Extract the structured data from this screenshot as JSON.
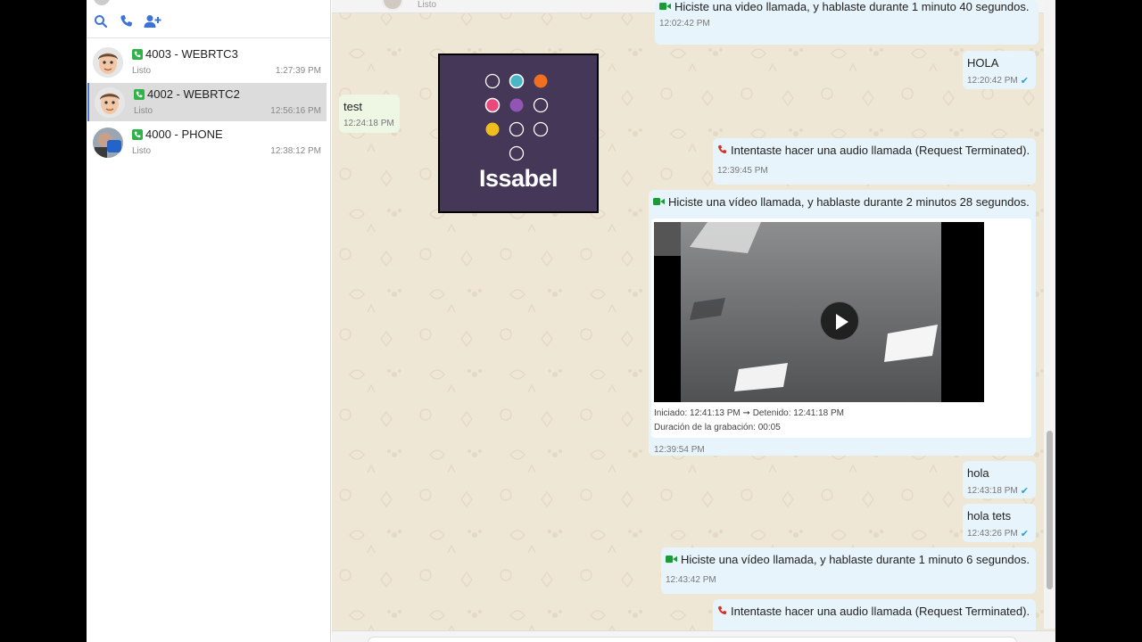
{
  "sidebar": {
    "toolbar": {
      "icons": [
        "search-icon",
        "phone-icon",
        "add-user-icon"
      ]
    },
    "contacts": [
      {
        "name": "4003 - WEBRTC3",
        "status": "Listo",
        "time": "1:27:39 PM",
        "active": false
      },
      {
        "name": "4002 - WEBRTC2",
        "status": "Listo",
        "time": "12:56:16 PM",
        "active": true
      },
      {
        "name": "4000 - PHONE",
        "status": "Listo",
        "time": "12:38:12 PM",
        "active": false
      }
    ]
  },
  "chat": {
    "header_status": "Listo",
    "messages": [
      {
        "text": "Hiciste una video llamada, y hablaste durante 1 minuto 40 segundos.",
        "time": "12:02:42 PM"
      },
      {
        "text": "HOLA",
        "time": "12:20:42 PM"
      },
      {
        "text": "test",
        "time": "12:24:18 PM"
      },
      {
        "text": "Intentaste hacer una audio llamada (Request Terminated).",
        "time": "12:39:45 PM"
      },
      {
        "text": "Hiciste una vídeo llamada, y hablaste durante 2 minutos 28 segundos.",
        "time": "12:39:54 PM",
        "recording": {
          "started": "Iniciado: 12:41:13 PM",
          "stopped": "Detenido: 12:41:18 PM",
          "duration": "Duración de la grabación: 00:05"
        }
      },
      {
        "text": "hola",
        "time": "12:43:18 PM"
      },
      {
        "text": "hola tets",
        "time": "12:43:26 PM"
      },
      {
        "text": "Hiciste una vídeo llamada, y hablaste durante 1 minuto 6 segundos.",
        "time": "12:43:42 PM"
      },
      {
        "text": "Intentaste hacer una audio llamada (Request Terminated).",
        "time": ""
      }
    ],
    "image_logo": {
      "text": "Issabel"
    }
  },
  "colors": {
    "accent": "#4b76d0",
    "phone_green": "#2fb348",
    "video_green": "#1a9c34",
    "call_red": "#d93025",
    "check_blue": "#2a9fd8",
    "logo_bg": "#443757"
  }
}
